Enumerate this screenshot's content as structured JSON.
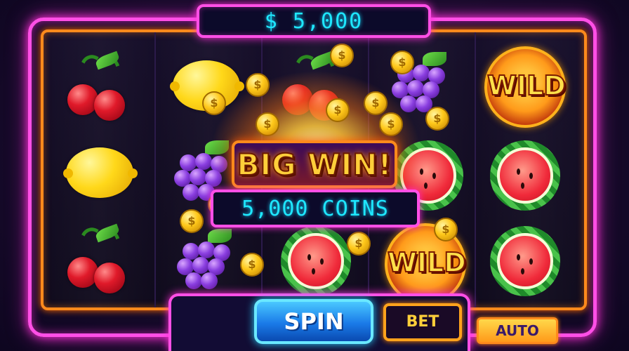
{
  "balance": {
    "text": "$ 5,000"
  },
  "win": {
    "title": "BIG WIN!",
    "amount": "5,000 COINS"
  },
  "wild_label": "WILD",
  "controls": {
    "spin": "SPIN",
    "bet": "BET",
    "auto": "AUTO"
  },
  "reels": [
    [
      "cherry",
      "lemon",
      "cherry"
    ],
    [
      "lemon",
      "grape",
      "grape"
    ],
    [
      "cherry",
      "burst",
      "watermelon"
    ],
    [
      "grape",
      "watermelon",
      "wild"
    ],
    [
      "wild",
      "watermelon",
      "watermelon"
    ]
  ],
  "colors": {
    "frame_neon": "#ff4fe6",
    "frame_orange": "#ff8a1c",
    "balance_text": "#1ee7ff",
    "spin_button": "#1a7ae8",
    "gold_text": "#ffcf3a"
  },
  "icons": {
    "coin": "dollar-coin-icon",
    "sparkle": "sparkle-icon"
  }
}
